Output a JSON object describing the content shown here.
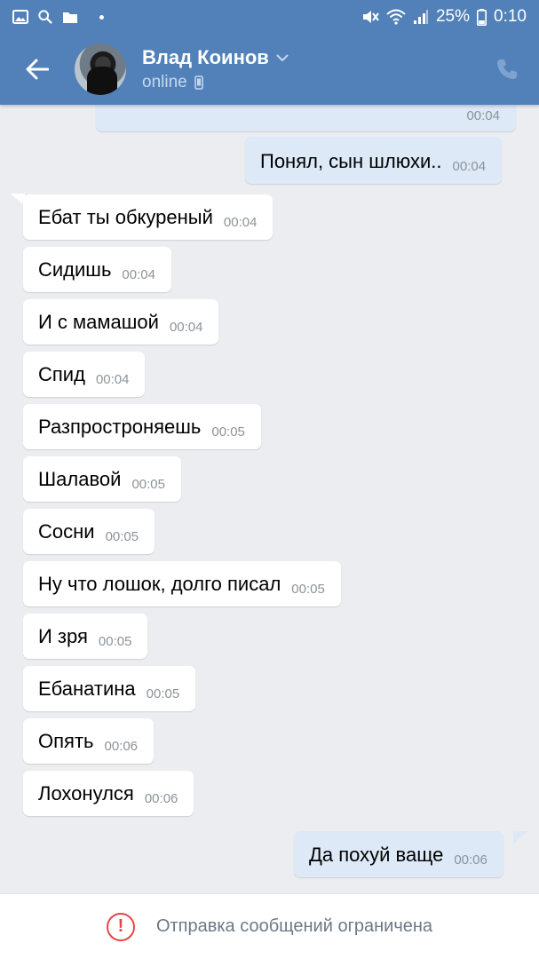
{
  "status_bar": {
    "battery": "25%",
    "time": "0:10",
    "icons": [
      "gallery-icon",
      "search-icon",
      "folder-icon",
      "mute-icon",
      "wifi-icon",
      "signal-icon",
      "battery-icon"
    ]
  },
  "header": {
    "contact_name": "Влад Коинов",
    "contact_status": "online",
    "icons": [
      "back-arrow-icon",
      "chevron-down-icon",
      "mobile-device-icon",
      "phone-icon"
    ]
  },
  "messages": [
    {
      "dir": "out",
      "text": "",
      "time": "00:04"
    },
    {
      "dir": "out",
      "text": "Понял, сын шлюхи..",
      "time": "00:04"
    },
    {
      "dir": "in",
      "text": "Ебат ты обкуреный",
      "time": "00:04"
    },
    {
      "dir": "in",
      "text": "Сидишь",
      "time": "00:04"
    },
    {
      "dir": "in",
      "text": "И с мамашой",
      "time": "00:04"
    },
    {
      "dir": "in",
      "text": "Спид",
      "time": "00:04"
    },
    {
      "dir": "in",
      "text": "Разпростроняешь",
      "time": "00:05"
    },
    {
      "dir": "in",
      "text": "Шалавой",
      "time": "00:05"
    },
    {
      "dir": "in",
      "text": "Сосни",
      "time": "00:05"
    },
    {
      "dir": "in",
      "text": "Ну что лошок, долго писал",
      "time": "00:05"
    },
    {
      "dir": "in",
      "text": "И зря",
      "time": "00:05"
    },
    {
      "dir": "in",
      "text": "Ебанатина",
      "time": "00:05"
    },
    {
      "dir": "in",
      "text": "Опять",
      "time": "00:06"
    },
    {
      "dir": "in",
      "text": "Лохонулся",
      "time": "00:06"
    },
    {
      "dir": "out",
      "text": "Да похуй ваще",
      "time": "00:06"
    }
  ],
  "bottom_bar": {
    "text": "Отправка сообщений ограничена",
    "icon": "warning-icon"
  },
  "colors": {
    "header_blue": "#5181b8",
    "chat_background": "#ebedf0",
    "incoming_bubble": "#ffffff",
    "outgoing_bubble": "#dde9f7",
    "warning_red": "#e64646"
  }
}
